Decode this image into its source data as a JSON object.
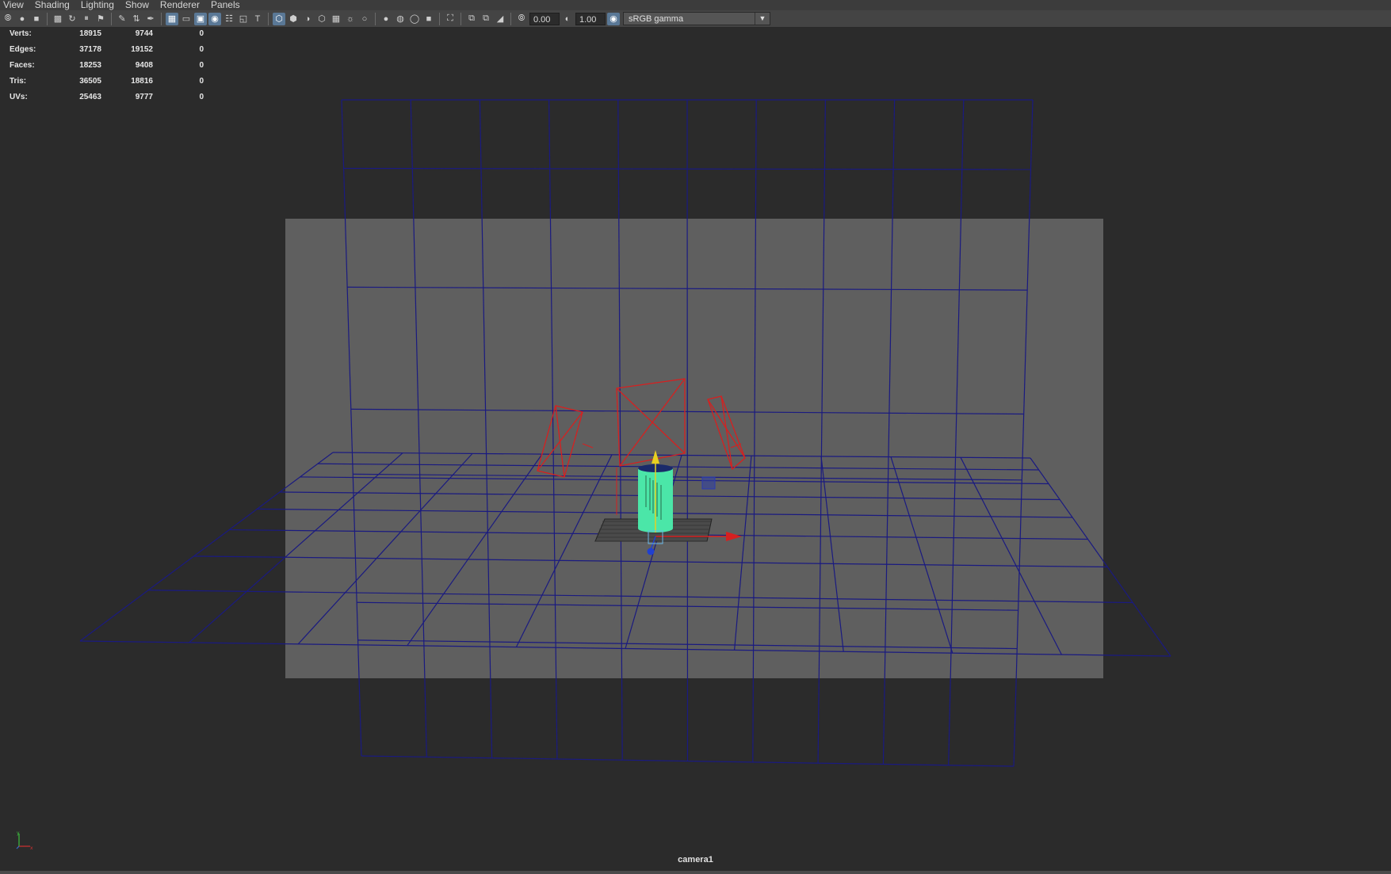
{
  "menu": [
    "View",
    "Shading",
    "Lighting",
    "Show",
    "Renderer",
    "Panels"
  ],
  "toolbar": {
    "exposure_value": "0.00",
    "gamma_value": "1.00",
    "color_space": "sRGB gamma",
    "icons": [
      "select-camera-icon",
      "camera-attributes-icon",
      "bookmark-icon",
      "image-plane-icon",
      "grid-icon",
      "film-gate-icon",
      "resolution-gate-icon",
      "gate-mask-icon",
      "field-chart-icon",
      "safe-action-icon",
      "safe-title-icon",
      "wireframe-icon",
      "smooth-shade-icon",
      "use-default-material-icon",
      "wireframe-on-shaded-icon",
      "xray-icon",
      "lights-icon",
      "shadows-icon",
      "ambient-occlusion-icon",
      "motion-blur-icon",
      "anti-aliasing-icon",
      "depth-of-field-icon",
      "isolate-select-icon",
      "xray-joints-icon",
      "xray-active-icon",
      "backface-culling-icon",
      "exposure-icon",
      "gamma-icon",
      "color-management-icon"
    ]
  },
  "hud": {
    "rows": [
      {
        "label": "Verts:",
        "v1": "18915",
        "v2": "9744",
        "v3": "0"
      },
      {
        "label": "Edges:",
        "v1": "37178",
        "v2": "19152",
        "v3": "0"
      },
      {
        "label": "Faces:",
        "v1": "18253",
        "v2": "9408",
        "v3": "0"
      },
      {
        "label": "Tris:",
        "v1": "36505",
        "v2": "18816",
        "v3": "0"
      },
      {
        "label": "UVs:",
        "v1": "25463",
        "v2": "9777",
        "v3": "0"
      }
    ]
  },
  "viewport": {
    "camera_name": "camera1",
    "colors": {
      "background": "#2b2b2b",
      "resolution_gate": "#5f5f5f",
      "wireframe": "#1a1a80",
      "light_wire": "#d62020",
      "selected_object": "#4be6a8"
    }
  }
}
